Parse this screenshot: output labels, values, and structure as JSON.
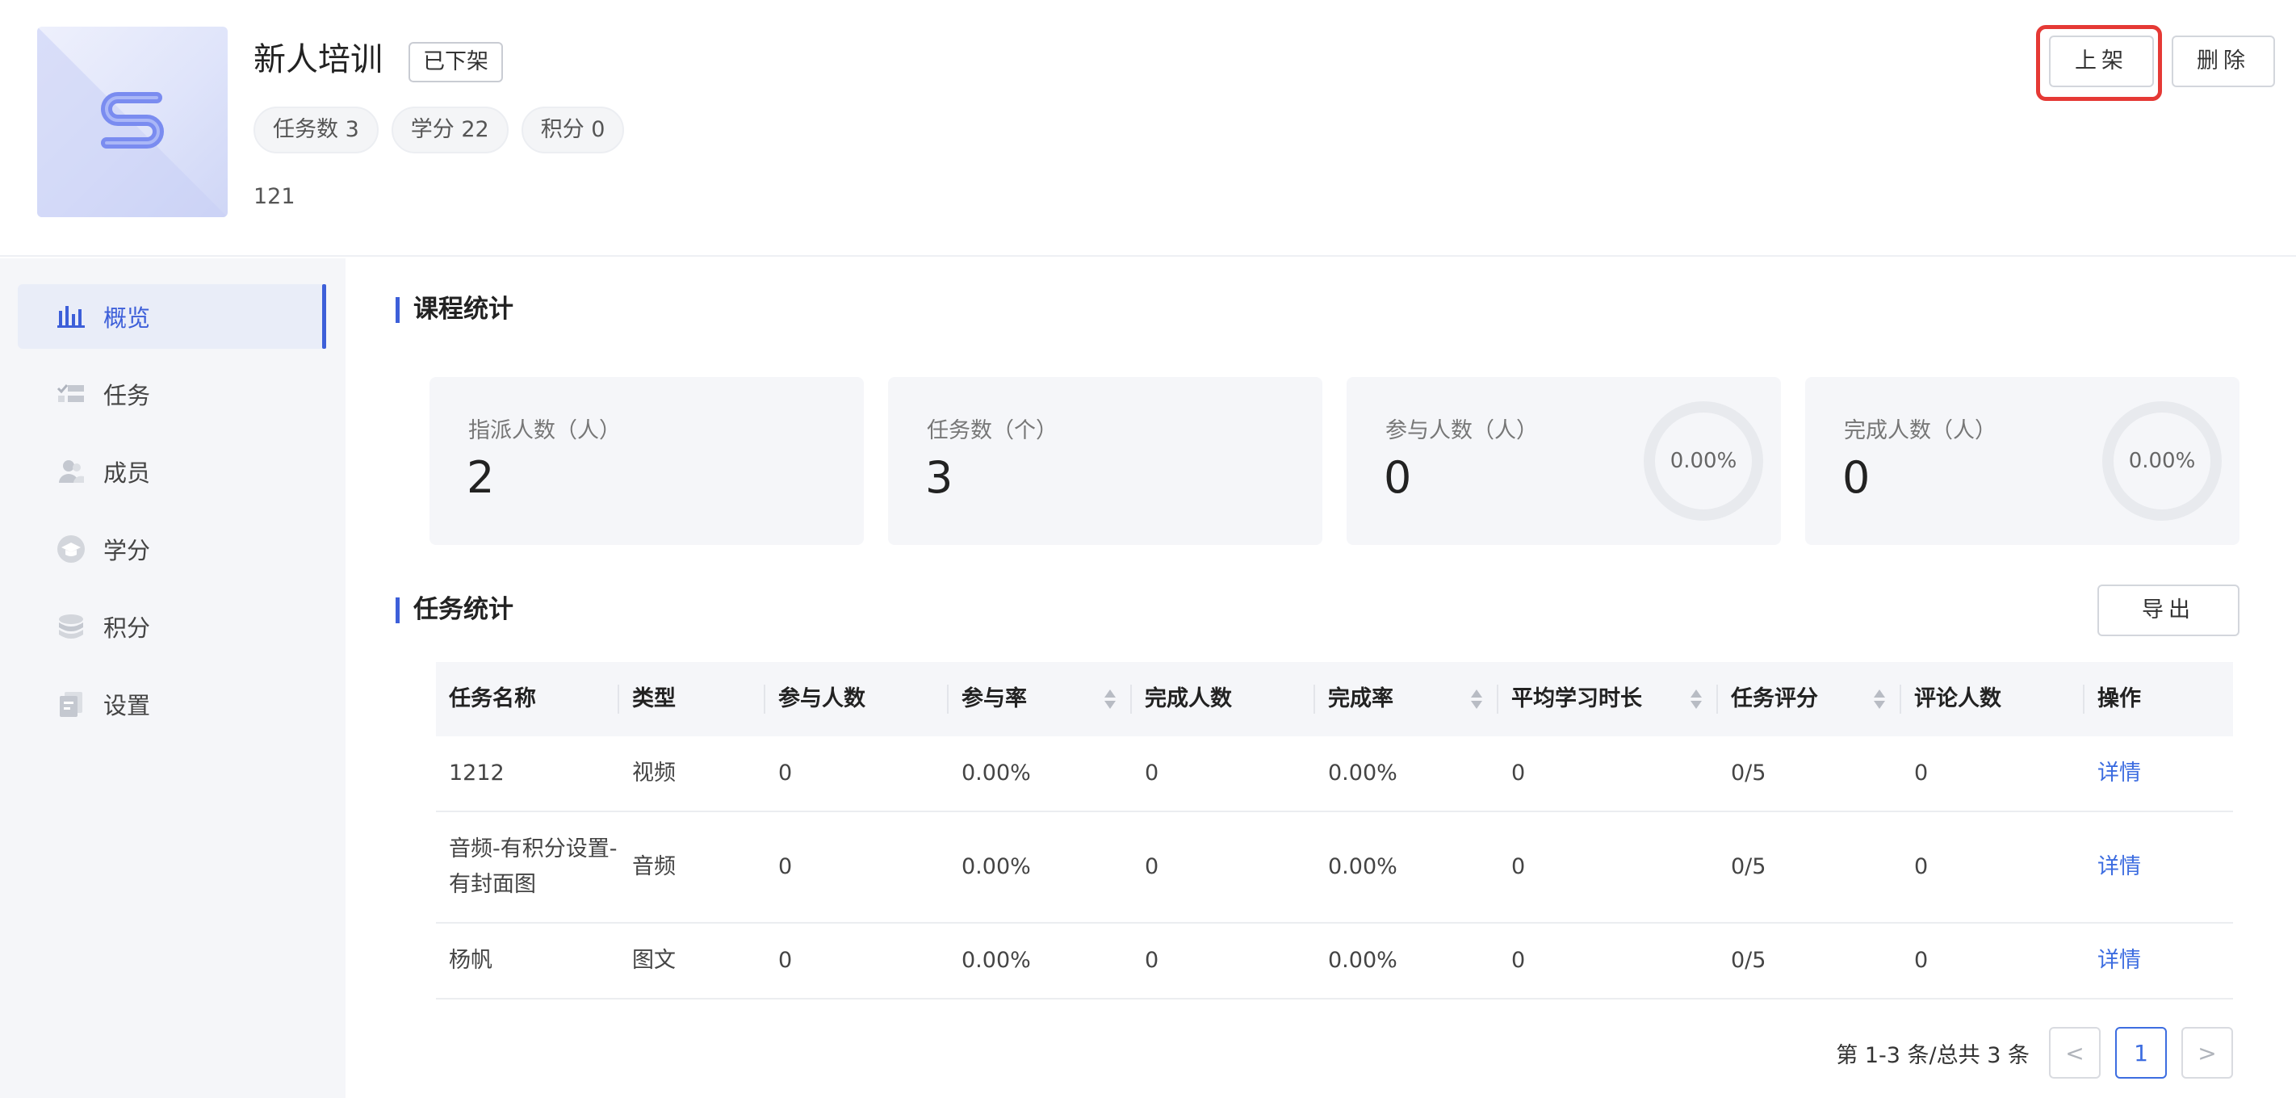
{
  "course": {
    "title": "新人培训",
    "status": "已下架",
    "chips": [
      "任务数 3",
      "学分 22",
      "积分 0"
    ],
    "description": "121"
  },
  "actions": {
    "publish": "上架",
    "delete": "删除"
  },
  "sidebar": {
    "items": [
      {
        "label": "概览",
        "icon": "bar-chart-icon",
        "active": true
      },
      {
        "label": "任务",
        "icon": "task-list-icon",
        "active": false
      },
      {
        "label": "成员",
        "icon": "users-icon",
        "active": false
      },
      {
        "label": "学分",
        "icon": "graduation-cap-icon",
        "active": false
      },
      {
        "label": "积分",
        "icon": "coins-icon",
        "active": false
      },
      {
        "label": "设置",
        "icon": "settings-icon",
        "active": false
      }
    ]
  },
  "course_stats": {
    "title": "课程统计",
    "cards": [
      {
        "label": "指派人数（人）",
        "value": "2"
      },
      {
        "label": "任务数（个）",
        "value": "3"
      },
      {
        "label": "参与人数（人）",
        "value": "0",
        "rate": "0.00%"
      },
      {
        "label": "完成人数（人）",
        "value": "0",
        "rate": "0.00%"
      }
    ]
  },
  "task_stats": {
    "title": "任务统计",
    "export": "导出",
    "columns": [
      "任务名称",
      "类型",
      "参与人数",
      "参与率",
      "完成人数",
      "完成率",
      "平均学习时长",
      "任务评分",
      "评论人数",
      "操作"
    ],
    "rows": [
      [
        "1212",
        "视频",
        "0",
        "0.00%",
        "0",
        "0.00%",
        "0",
        "0/5",
        "0",
        "详情"
      ],
      [
        "音频-有积分设置-有封面图",
        "音频",
        "0",
        "0.00%",
        "0",
        "0.00%",
        "0",
        "0/5",
        "0",
        "详情"
      ],
      [
        "杨帆",
        "图文",
        "0",
        "0.00%",
        "0",
        "0.00%",
        "0",
        "0/5",
        "0",
        "详情"
      ]
    ]
  },
  "pagination": {
    "summary": "第 1-3 条/总共 3 条",
    "current": "1",
    "prev": "<",
    "next": ">"
  },
  "colors": {
    "accent": "#3d5fd9",
    "link": "#3d6de0",
    "highlight": "#e53935"
  }
}
